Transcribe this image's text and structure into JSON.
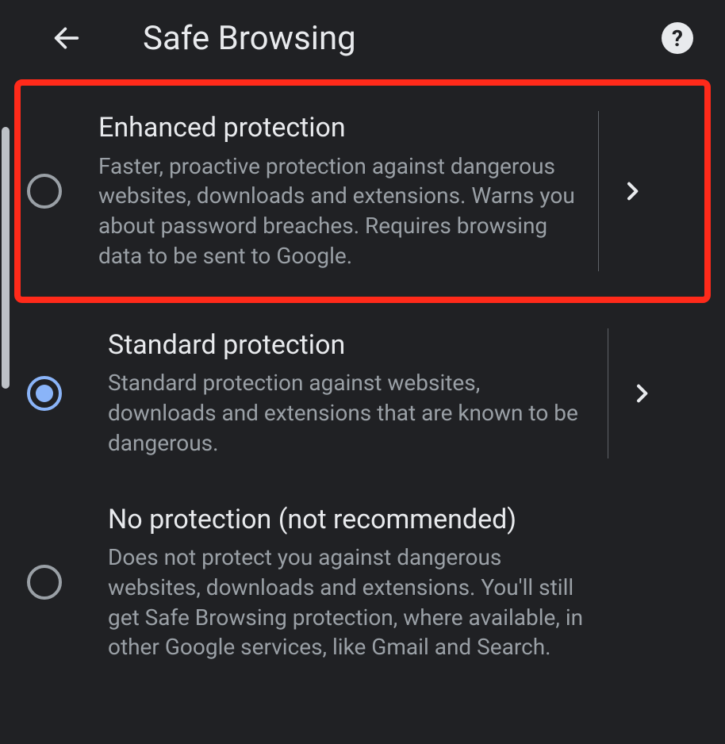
{
  "header": {
    "title": "Safe Browsing"
  },
  "options": [
    {
      "title": "Enhanced protection",
      "description": "Faster, proactive protection against dangerous websites, downloads and extensions. Warns you about password breaches. Requires browsing data to be sent to Google."
    },
    {
      "title": "Standard protection",
      "description": "Standard protection against websites, downloads and extensions that are known to be dangerous."
    },
    {
      "title": "No protection (not recommended)",
      "description": "Does not protect you against dangerous websites, downloads and extensions. You'll still get Safe Browsing protection, where available, in other Google services, like Gmail and Search."
    }
  ],
  "selected_index": 1,
  "highlighted_index": 0
}
